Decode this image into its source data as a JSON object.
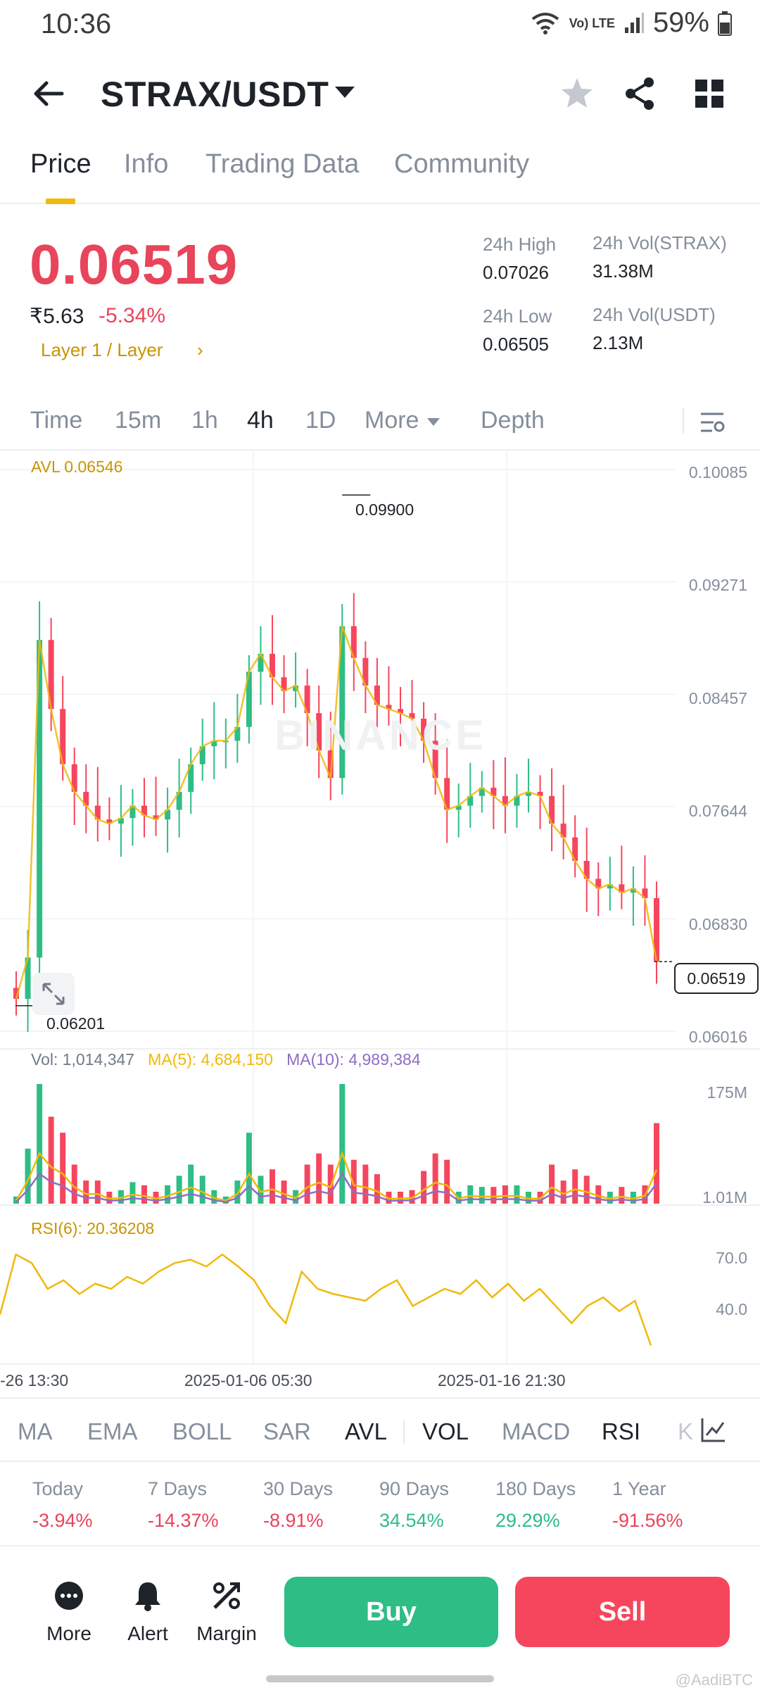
{
  "status_bar": {
    "time": "10:36",
    "network": "Vo) LTE",
    "battery": "59%"
  },
  "header": {
    "pair": "STRAX/USDT",
    "icons": [
      "back-arrow-icon",
      "star-icon",
      "share-icon",
      "grid-icon"
    ]
  },
  "tabs": [
    {
      "label": "Price",
      "active": true
    },
    {
      "label": "Info",
      "active": false
    },
    {
      "label": "Trading Data",
      "active": false
    },
    {
      "label": "Community",
      "active": false
    }
  ],
  "price": {
    "last": "0.06519",
    "inr": "₹5.63",
    "change": "-5.34%",
    "tag": "Layer 1 / Layer",
    "tag_arrow": "›"
  },
  "stats": {
    "high_label": "24h High",
    "high_value": "0.07026",
    "low_label": "24h Low",
    "low_value": "0.06505",
    "vol_strax_label": "24h Vol(STRAX)",
    "vol_strax_value": "31.38M",
    "vol_usdt_label": "24h Vol(USDT)",
    "vol_usdt_value": "2.13M"
  },
  "intervals": [
    {
      "label": "Time",
      "active": false
    },
    {
      "label": "15m",
      "active": false
    },
    {
      "label": "1h",
      "active": false
    },
    {
      "label": "4h",
      "active": true
    },
    {
      "label": "1D",
      "active": false
    },
    {
      "label": "More",
      "active": false
    },
    {
      "label": "Depth",
      "active": false
    }
  ],
  "chart": {
    "avl_label": "AVL 0.06546",
    "price_axis": [
      "0.10085",
      "0.09271",
      "0.08457",
      "0.07644",
      "0.06830",
      "0.06016"
    ],
    "high_marker": "0.09900",
    "low_marker": "0.06201",
    "current_price": "0.06519",
    "watermark": "BINANCE",
    "vol_legend": {
      "vol": "Vol: 1,014,347",
      "ma5": "MA(5): 4,684,150",
      "ma10": "MA(10): 4,989,384"
    },
    "vol_axis": [
      "175M",
      "1.01M"
    ],
    "rsi_legend": "RSI(6): 20.36208",
    "rsi_axis": [
      "70.0",
      "40.0"
    ],
    "time_axis": [
      "-26 13:30",
      "2025-01-06 05:30",
      "2025-01-16 21:30"
    ],
    "colors": {
      "up": "#2ebd85",
      "down": "#f6465d",
      "ma5": "#f0b90b",
      "ma10": "#8f6dc4",
      "rsi": "#f0b90b"
    }
  },
  "chart_data": {
    "type": "candlestick",
    "x_range": [
      "12-26 13:30",
      "2025-01-24"
    ],
    "y_range": [
      0.06016,
      0.10085
    ],
    "price_high": 0.099,
    "price_low": 0.06201,
    "close_series": [
      0.0625,
      0.0655,
      0.0885,
      0.0835,
      0.0795,
      0.0775,
      0.0765,
      0.0755,
      0.0752,
      0.0756,
      0.0765,
      0.0758,
      0.0755,
      0.0762,
      0.0775,
      0.0795,
      0.0808,
      0.0812,
      0.0812,
      0.0822,
      0.0862,
      0.0875,
      0.0858,
      0.0848,
      0.0852,
      0.0832,
      0.0805,
      0.0785,
      0.0895,
      0.0872,
      0.0852,
      0.0838,
      0.0835,
      0.0832,
      0.0828,
      0.0812,
      0.0785,
      0.0762,
      0.0765,
      0.0772,
      0.0778,
      0.0772,
      0.0765,
      0.0772,
      0.0775,
      0.0772,
      0.0752,
      0.0742,
      0.0725,
      0.0712,
      0.0705,
      0.0708,
      0.0702,
      0.0705,
      0.0698,
      0.0652
    ],
    "rsi_series": [
      40,
      75,
      70,
      55,
      60,
      52,
      58,
      55,
      62,
      58,
      65,
      70,
      72,
      68,
      75,
      68,
      60,
      45,
      35,
      65,
      55,
      52,
      50,
      48,
      55,
      60,
      45,
      50,
      55,
      52,
      60,
      50,
      58,
      48,
      55,
      45,
      35,
      45,
      50,
      42,
      48,
      22
    ],
    "volume_peaks": [
      "175M",
      "1.01M"
    ]
  },
  "indicators": [
    {
      "label": "MA",
      "active": false
    },
    {
      "label": "EMA",
      "active": false
    },
    {
      "label": "BOLL",
      "active": false
    },
    {
      "label": "SAR",
      "active": false
    },
    {
      "label": "AVL",
      "active": true
    },
    {
      "label": "VOL",
      "active": true
    },
    {
      "label": "MACD",
      "active": false
    },
    {
      "label": "RSI",
      "active": true
    },
    {
      "label": "K",
      "active": false
    }
  ],
  "performance": [
    {
      "label": "Today",
      "value": "-3.94%",
      "dir": "neg"
    },
    {
      "label": "7 Days",
      "value": "-14.37%",
      "dir": "neg"
    },
    {
      "label": "30 Days",
      "value": "-8.91%",
      "dir": "neg"
    },
    {
      "label": "90 Days",
      "value": "34.54%",
      "dir": "pos"
    },
    {
      "label": "180 Days",
      "value": "29.29%",
      "dir": "pos"
    },
    {
      "label": "1 Year",
      "value": "-91.56%",
      "dir": "neg"
    }
  ],
  "bottom_bar": {
    "more": "More",
    "alert": "Alert",
    "margin": "Margin",
    "buy": "Buy",
    "sell": "Sell"
  },
  "credit": "@AadiBTC"
}
